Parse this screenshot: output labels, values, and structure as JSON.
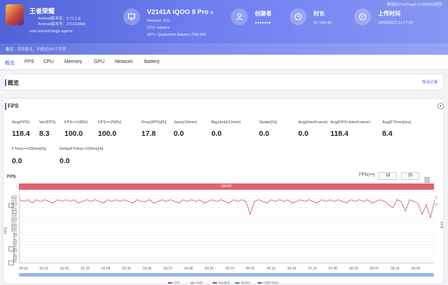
{
  "app": {
    "name": "王者荣耀",
    "android_version_label": "Android版本名：3.71.1.8",
    "android_version_code": "Android版本号：371010800",
    "package": "com.tencent.tmgp.sgame"
  },
  "device": {
    "name": "V2141A iQOO 8 Pro",
    "memory": "Memory: 11G",
    "cpu": "CPU: lahaina",
    "gpu": "GPU: Qualcomm Adreno (TM) 660"
  },
  "creator": {
    "label": "创建者",
    "value": "●●●●●●●"
  },
  "duration": {
    "label": "时长",
    "value": "0h 10m 8s"
  },
  "upload": {
    "label": "上传时间",
    "value": "29/09/2021 11:17:03"
  },
  "header_note": "数据由PerfDog(6.0.210836)提供",
  "remark": {
    "label": "备注：",
    "placeholder": "添加备注，不超过200个字符"
  },
  "tabs": [
    "概览",
    "FPS",
    "CPU",
    "Memory",
    "GPU",
    "Network",
    "Battery"
  ],
  "overview": {
    "title": "概览",
    "export": "导出记录"
  },
  "fps_section": {
    "title": "FPS",
    "stats_row1": [
      {
        "label": "Avg(FPS)",
        "value": "118.4"
      },
      {
        "label": "Var(FPS)",
        "value": "8.3"
      },
      {
        "label": "FPS>=18[%]",
        "value": "100.0"
      },
      {
        "label": "FPS>=25[%]",
        "value": "100.0"
      },
      {
        "label": "Drop(FPS)[/h]",
        "value": "17.8"
      },
      {
        "label": "Jank(/10min)",
        "value": "0.0"
      },
      {
        "label": "BigJank(/10min)",
        "value": "0.0"
      },
      {
        "label": "Stutter[%]",
        "value": "0.0"
      },
      {
        "label": "Avg(InterFrame)",
        "value": "0.0"
      },
      {
        "label": "Avg(FPS+InterFrame)",
        "value": "118.4"
      },
      {
        "label": "Avg(FTime)[ms]",
        "value": "8.4"
      }
    ],
    "stats_row2": [
      {
        "label": "FTime>=100ms[%]",
        "value": "0.0"
      },
      {
        "label": "Delta(FTime)>100ms[/h]",
        "value": "0.0"
      }
    ]
  },
  "chart_header": {
    "title": "FPS",
    "range_label": "FPS(>=)",
    "range_min": "18",
    "range_max": "25",
    "label_bar": "label1"
  },
  "chart_data": {
    "type": "line",
    "title": "FPS",
    "ylabel": "FPS",
    "y2label": "Jank",
    "ylim": [
      80,
      123
    ],
    "yticks": [
      "123",
      "121",
      "119",
      "117",
      "115",
      "113",
      "111",
      "109",
      "107",
      "105",
      "103",
      "101",
      "99",
      "97",
      "95",
      "93",
      "91",
      "89",
      "87",
      "85",
      "83",
      "81"
    ],
    "xticks": [
      "00:00",
      "00:31",
      "01:02",
      "01:33",
      "02:04",
      "02:35",
      "03:06",
      "03:37",
      "04:08",
      "04:39",
      "05:10",
      "05:41",
      "06:12",
      "06:43",
      "07:14",
      "07:45",
      "08:16",
      "08:47",
      "09:18",
      "09:49"
    ],
    "y2ticks": [
      "1",
      "0"
    ],
    "series": [
      {
        "name": "FPS",
        "color": "#c24b8a",
        "values": [
          119,
          118,
          119,
          117,
          119,
          118,
          119,
          118,
          117,
          119,
          118,
          119,
          118,
          119,
          117,
          118,
          119,
          118,
          119,
          118,
          117,
          119,
          118,
          119,
          118,
          119,
          118,
          117,
          119,
          118,
          118,
          119,
          117,
          118,
          119,
          118,
          119,
          118,
          117,
          119,
          118,
          119,
          118,
          119,
          117,
          118,
          119,
          118,
          119,
          118,
          117,
          119,
          118,
          119,
          118,
          110,
          118,
          119,
          118,
          117,
          119,
          118,
          119,
          118,
          119,
          117,
          118,
          119,
          118,
          119,
          118,
          117,
          119,
          118,
          119,
          118,
          119,
          118,
          117,
          119,
          118,
          119,
          118,
          119,
          117,
          118,
          119,
          118,
          116,
          114,
          119,
          118,
          112,
          119,
          118,
          117,
          110,
          116,
          108,
          119
        ]
      },
      {
        "name": "Jank",
        "color": "#f0a030"
      },
      {
        "name": "BigJank",
        "color": "#d23b3b"
      },
      {
        "name": "Stutter",
        "color": "#3a7bd5"
      },
      {
        "name": "InterFrame",
        "color": "#7a53c8"
      }
    ]
  },
  "colors": {
    "accent": "#4f63d8",
    "label_bar": "#e0646f"
  }
}
